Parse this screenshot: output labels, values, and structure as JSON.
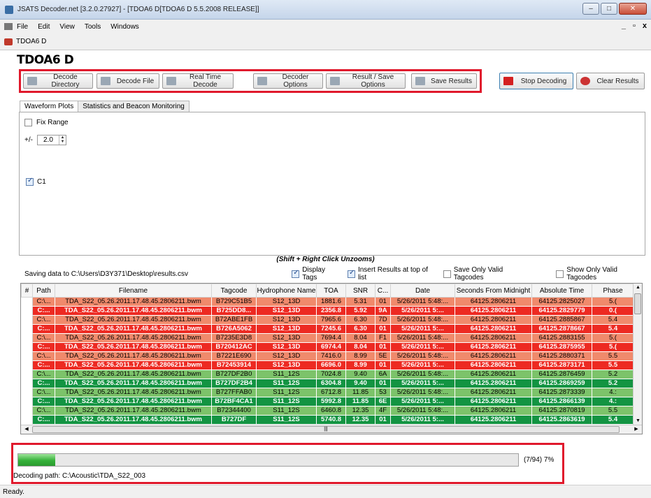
{
  "window": {
    "title": "JSATS Decoder.net [3.2.0.27927] - [TDOA6 D[TDOA6 D 5.5.2008 RELEASE]]",
    "controls": [
      "–",
      "□",
      "✕"
    ]
  },
  "menu": {
    "items": [
      "File",
      "Edit",
      "View",
      "Tools",
      "Windows"
    ],
    "mdi_controls": [
      "_",
      "▫",
      "x"
    ]
  },
  "doc_tab": {
    "label": "TDOA6 D"
  },
  "panel": {
    "title": "TDOA6 D"
  },
  "toolbar": {
    "buttons": [
      "Decode Directory",
      "Decode File",
      "Real Time Decode",
      "Decoder Options",
      "Result / Save Options",
      "Save Results"
    ],
    "stop_label": "Stop Decoding",
    "clear_label": "Clear Results",
    "icons": [
      "folder-icon",
      "file-icon",
      "clock-icon",
      "gear-icon",
      "table-icon",
      "floppy-icon",
      "stop-icon",
      "eraser-icon"
    ]
  },
  "tabs": [
    "Waveform Plots",
    "Statistics and Beacon Monitoring"
  ],
  "plot_panel": {
    "fix_range_label": "Fix Range",
    "fix_range_checked": false,
    "plusminus_label": "+/-",
    "range_value": "2.0",
    "channel_label": "C1",
    "channel_checked": true
  },
  "unzoom_hint": "(Shift + Right Click Unzooms)",
  "options_bar": {
    "saving_path": "Saving data to C:\\Users\\D3Y371\\Desktop\\results.csv",
    "display_tags": "Display Tags",
    "insert_top": "Insert Results at top of list",
    "save_valid": "Save Only Valid Tagcodes",
    "show_valid": "Show Only Valid Tagcodes"
  },
  "table": {
    "columns": [
      "#",
      "Path",
      "Filename",
      "Tagcode",
      "Hydrophone Name",
      "TOA",
      "SNR",
      "C...",
      "Date",
      "Seconds From Midnight",
      "Absolute Time",
      "Phase"
    ],
    "rows": [
      {
        "style": "lsal",
        "path": "C:\\...",
        "filename": "TDA_S22_05.26.2011.17.48.45.2806211.bwm",
        "tagcode": "B729C51B5",
        "hydrophone": "S12_13D",
        "toa": "1881.6",
        "snr": "5.31",
        "c": "01",
        "date": "5/26/2011 5:48:...",
        "sfm": "64125.2806211",
        "abs": "64125.2825027",
        "phase": "5.("
      },
      {
        "style": "red",
        "path": "C:...",
        "filename": "TDA_S22_05.26.2011.17.48.45.2806211.bwm",
        "tagcode": "B725DD8...",
        "hydrophone": "S12_13D",
        "toa": "2356.8",
        "snr": "5.92",
        "c": "9A",
        "date": "5/26/2011 5:...",
        "sfm": "64125.2806211",
        "abs": "64125.2829779",
        "phase": "0.("
      },
      {
        "style": "lsal",
        "path": "C:\\...",
        "filename": "TDA_S22_05.26.2011.17.48.45.2806211.bwm",
        "tagcode": "B72ABE1FB",
        "hydrophone": "S12_13D",
        "toa": "7965.6",
        "snr": "6.30",
        "c": "7D",
        "date": "5/26/2011 5:48:...",
        "sfm": "64125.2806211",
        "abs": "64125.2885867",
        "phase": "5.4"
      },
      {
        "style": "red",
        "path": "C:...",
        "filename": "TDA_S22_05.26.2011.17.48.45.2806211.bwm",
        "tagcode": "B726A5062",
        "hydrophone": "S12_13D",
        "toa": "7245.6",
        "snr": "6.30",
        "c": "01",
        "date": "5/26/2011 5:...",
        "sfm": "64125.2806211",
        "abs": "64125.2878667",
        "phase": "5.4"
      },
      {
        "style": "lsal",
        "path": "C:\\...",
        "filename": "TDA_S22_05.26.2011.17.48.45.2806211.bwm",
        "tagcode": "B7235E3D8",
        "hydrophone": "S12_13D",
        "toa": "7694.4",
        "snr": "8.04",
        "c": "F1",
        "date": "5/26/2011 5:48:...",
        "sfm": "64125.2806211",
        "abs": "64125.2883155",
        "phase": "5.("
      },
      {
        "style": "red",
        "path": "C:...",
        "filename": "TDA_S22_05.26.2011.17.48.45.2806211.bwm",
        "tagcode": "B720412AC",
        "hydrophone": "S12_13D",
        "toa": "6974.4",
        "snr": "8.04",
        "c": "01",
        "date": "5/26/2011 5:...",
        "sfm": "64125.2806211",
        "abs": "64125.2875955",
        "phase": "5.("
      },
      {
        "style": "lsal",
        "path": "C:\\...",
        "filename": "TDA_S22_05.26.2011.17.48.45.2806211.bwm",
        "tagcode": "B7221E690",
        "hydrophone": "S12_13D",
        "toa": "7416.0",
        "snr": "8.99",
        "c": "5E",
        "date": "5/26/2011 5:48:...",
        "sfm": "64125.2806211",
        "abs": "64125.2880371",
        "phase": "5.5"
      },
      {
        "style": "red",
        "path": "C:...",
        "filename": "TDA_S22_05.26.2011.17.48.45.2806211.bwm",
        "tagcode": "B72453914",
        "hydrophone": "S12_13D",
        "toa": "6696.0",
        "snr": "8.99",
        "c": "01",
        "date": "5/26/2011 5:...",
        "sfm": "64125.2806211",
        "abs": "64125.2873171",
        "phase": "5.5"
      },
      {
        "style": "lgrn",
        "path": "C:\\...",
        "filename": "TDA_S22_05.26.2011.17.48.45.2806211.bwm",
        "tagcode": "B727DF2B0",
        "hydrophone": "S11_12S",
        "toa": "7024.8",
        "snr": "9.40",
        "c": "6A",
        "date": "5/26/2011 5:48:...",
        "sfm": "64125.2806211",
        "abs": "64125.2876459",
        "phase": "5.2"
      },
      {
        "style": "dgrn",
        "path": "C:...",
        "filename": "TDA_S22_05.26.2011.17.48.45.2806211.bwm",
        "tagcode": "B727DF2B4",
        "hydrophone": "S11_12S",
        "toa": "6304.8",
        "snr": "9.40",
        "c": "01",
        "date": "5/26/2011 5:...",
        "sfm": "64125.2806211",
        "abs": "64125.2869259",
        "phase": "5.2"
      },
      {
        "style": "lgrn",
        "path": "C:\\...",
        "filename": "TDA_S22_05.26.2011.17.48.45.2806211.bwm",
        "tagcode": "B727FFAB0",
        "hydrophone": "S11_12S",
        "toa": "6712.8",
        "snr": "11.85",
        "c": "53",
        "date": "5/26/2011 5:48:...",
        "sfm": "64125.2806211",
        "abs": "64125.2873339",
        "phase": "4.:"
      },
      {
        "style": "dgrn",
        "path": "C:...",
        "filename": "TDA_S22_05.26.2011.17.48.45.2806211.bwm",
        "tagcode": "B72BF4CA1",
        "hydrophone": "S11_12S",
        "toa": "5992.8",
        "snr": "11.85",
        "c": "6E",
        "date": "5/26/2011 5:...",
        "sfm": "64125.2806211",
        "abs": "64125.2866139",
        "phase": "4.:"
      },
      {
        "style": "lgrn",
        "path": "C:\\...",
        "filename": "TDA_S22_05.26.2011.17.48.45.2806211.bwm",
        "tagcode": "B72344400",
        "hydrophone": "S11_12S",
        "toa": "6460.8",
        "snr": "12.35",
        "c": "4F",
        "date": "5/26/2011 5:48:...",
        "sfm": "64125.2806211",
        "abs": "64125.2870819",
        "phase": "5.5"
      },
      {
        "style": "dgrn",
        "path": "C:...",
        "filename": "TDA_S22_05.26.2011.17.48.45.2806211.bwm",
        "tagcode": "B727DF",
        "hydrophone": "S11_12S",
        "toa": "5740.8",
        "snr": "12.35",
        "c": "01",
        "date": "5/26/2011 5:...",
        "sfm": "64125.2806211",
        "abs": "64125.2863619",
        "phase": "5.4"
      }
    ]
  },
  "progress": {
    "fraction": 0.074,
    "text": "(7/94) 7%"
  },
  "decoding_path": "Decoding path: C:\\Acoustic\\TDA_S22_003",
  "status_text": "Ready.",
  "colors": {
    "highlight_border": "#e0192c",
    "row_light_salmon": "#f08a6c",
    "row_red": "#ed2a22",
    "row_light_green": "#7cc36a",
    "row_dark_green": "#139442",
    "progress_green": "#35b13a"
  }
}
